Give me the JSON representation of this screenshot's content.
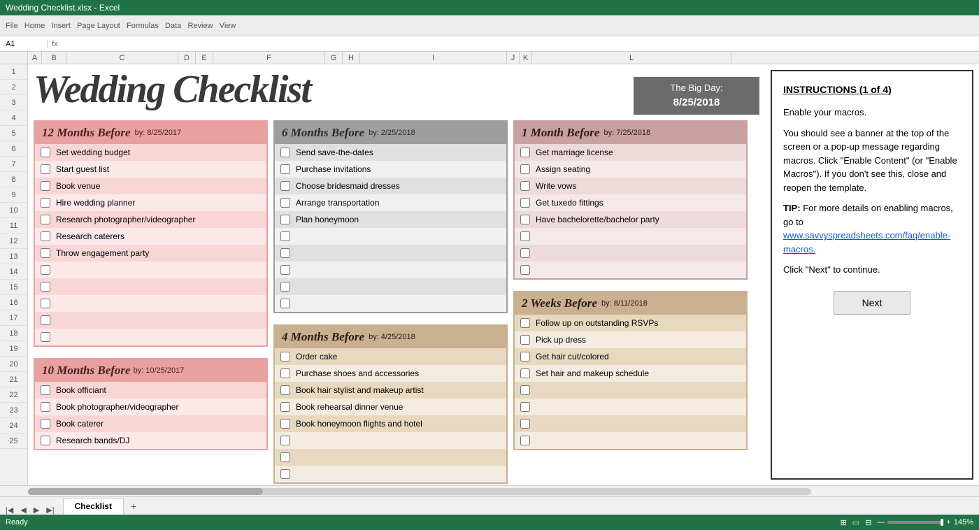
{
  "app": {
    "title": "Wedding Checklist",
    "status": "Ready",
    "zoom": "145%",
    "sheet_tab": "Checklist"
  },
  "big_day": {
    "label": "The Big Day:",
    "date": "8/25/2018"
  },
  "instructions": {
    "title": "INSTRUCTIONS",
    "page_info": "(1 of 4)",
    "step1": "Enable your macros.",
    "step2": "You should see a banner at the top of the screen or a pop-up message regarding macros.  Click \"Enable Content\" (or \"Enable Macros\").  If you don't see this, close and reopen the template.",
    "tip_label": "TIP:",
    "tip_text": " For more details on enabling macros, go to ",
    "tip_link": "www.savvyspreadsheets.com/faq/enable-macros.",
    "step3": "Click \"Next\" to continue.",
    "next_button": "Next"
  },
  "sections": {
    "twelve_months": {
      "title": "12 Months Before",
      "by_date": "by: 8/25/2017",
      "items": [
        "Set wedding budget",
        "Start guest list",
        "Book venue",
        "Hire wedding planner",
        "Research photographer/videographer",
        "Research caterers",
        "Throw engagement party"
      ]
    },
    "ten_months": {
      "title": "10 Months Before",
      "by_date": "by: 10/25/2017",
      "items": [
        "Book officiant",
        "Book photographer/videographer",
        "Book caterer",
        "Research bands/DJ"
      ]
    },
    "six_months": {
      "title": "6 Months Before",
      "by_date": "by: 2/25/2018",
      "items": [
        "Send save-the-dates",
        "Purchase invitations",
        "Choose bridesmaid dresses",
        "Arrange transportation",
        "Plan honeymoon"
      ]
    },
    "four_months": {
      "title": "4 Months Before",
      "by_date": "by: 4/25/2018",
      "items": [
        "Order cake",
        "Purchase shoes and accessories",
        "Book hair stylist and makeup artist",
        "Book rehearsal dinner venue",
        "Book honeymoon flights and hotel"
      ]
    },
    "one_month": {
      "title": "1 Month Before",
      "by_date": "by: 7/25/2018",
      "items": [
        "Get marriage license",
        "Assign seating",
        "Write vows",
        "Get tuxedo fittings",
        "Have bachelorette/bachelor party"
      ]
    },
    "two_weeks": {
      "title": "2 Weeks Before",
      "by_date": "by: 8/11/2018",
      "items": [
        "Follow up on outstanding RSVPs",
        "Pick up dress",
        "Get hair cut/colored",
        "Set hair and makeup schedule"
      ]
    }
  },
  "col_headers": [
    "A",
    "B",
    "C",
    "D",
    "E",
    "F",
    "G",
    "H",
    "I",
    "J",
    "K",
    "L"
  ],
  "row_numbers": [
    1,
    2,
    3,
    4,
    5,
    6,
    7,
    8,
    9,
    10,
    11,
    12,
    13,
    14,
    15,
    16,
    17,
    18,
    19,
    20,
    21,
    22,
    23,
    24,
    25
  ]
}
